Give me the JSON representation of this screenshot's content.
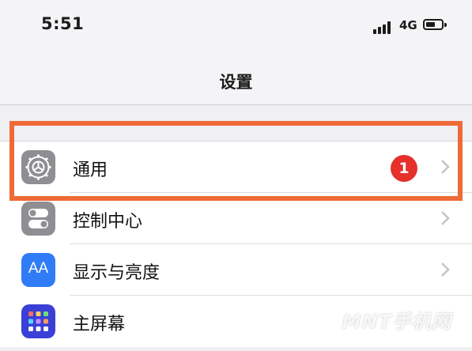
{
  "status_bar": {
    "time": "5:51",
    "network": "4G",
    "battery_level": 0.45
  },
  "nav": {
    "title": "设置"
  },
  "settings": [
    {
      "label": "通用",
      "icon": "gear-icon",
      "badge": "1"
    },
    {
      "label": "控制中心",
      "icon": "toggles-icon"
    },
    {
      "label": "显示与亮度",
      "icon": "text-size-icon",
      "icon_text": "AA"
    },
    {
      "label": "主屏幕",
      "icon": "app-grid-icon"
    }
  ],
  "colors": {
    "highlight": "#ef6a36",
    "badge": "#e5302b",
    "gear_icon_bg": "#8e8e93",
    "display_icon_bg": "#2f7cf6",
    "home_icon_bg": "#3a3fd6"
  },
  "watermark": "MNT手机网"
}
